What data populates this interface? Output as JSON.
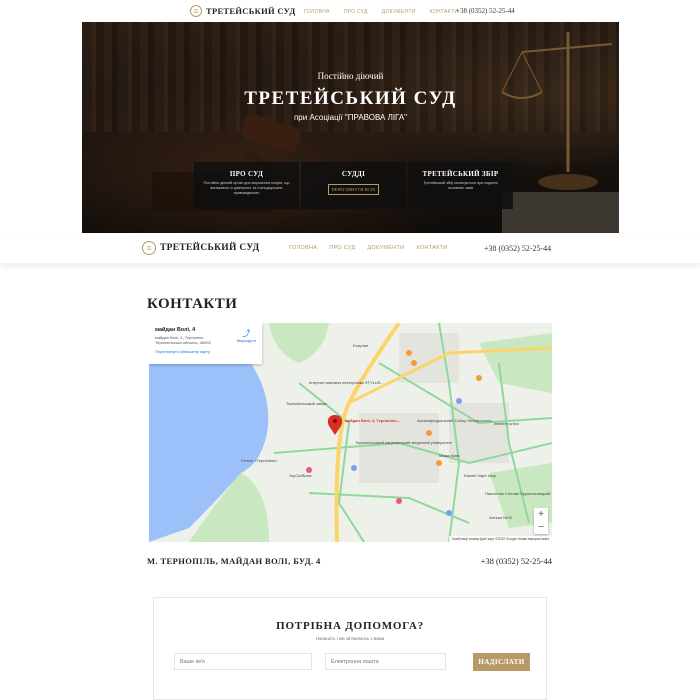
{
  "brand": {
    "name": "ТРЕТЕЙСЬКИЙ СУД"
  },
  "nav": {
    "home": "ГОЛОВНА",
    "about": "ПРО СУД",
    "docs": "ДОКУМЕНТИ",
    "contacts": "КОНТАКТИ"
  },
  "phone": "+38 (0352) 52-25-44",
  "hero": {
    "kicker": "Постійно діючий",
    "title": "ТРЕТЕЙСЬКИЙ СУД",
    "subtitle": "при Асоціації \"ПРАВОВА ЛІГА\"",
    "cards": [
      {
        "title": "ПРО СУД",
        "desc": "Постійно діючий орган для вирішення спорів, що виникають із цивільних та господарських правовідносин"
      },
      {
        "title": "СУДДІ",
        "button": "ПЕРЕГЛЯНУТИ ВСІХ"
      },
      {
        "title": "ТРЕТЕЙСЬКИЙ ЗБІР",
        "desc": "Третейський збір сплачується при поданні позовних заяв"
      }
    ]
  },
  "page_title": "КОНТАКТИ",
  "map": {
    "place": "майдан Волі, 4",
    "address": "майдан Волі, 4, Тернопіль, Тернопільська область, 46002",
    "larger_map": "Переглянути збільшену карту",
    "directions": "Маршрути",
    "pin_label": "майдан Волі, 4, Тернопіль...",
    "footer": "Комбінації клавіш   Дані карт ©2022 Google   Умови використання",
    "zoom_in": "+",
    "zoom_out": "−",
    "labels": [
      "Тернопільський замок",
      "Архикафедральний Собор Непорочного...",
      "Готель «Тернопіль»",
      "Тернопільський національний медичний університет",
      "Kandel Vape shop",
      "Пам'ятник Соломії Крушельницькій",
      "УкрСибБанк",
      "Аптека №78",
      "Інтернет-магазин електроніки STYLUS...",
      "western union",
      "Мама Кава",
      "Ескулап"
    ]
  },
  "address_line": "М. ТЕРНОПІЛЬ, МАЙДАН ВОЛІ, БУД. 4",
  "help": {
    "title": "ПОТРІБНА ДОПОМОГА?",
    "subtitle": "Напишіть і ми зв'яжемось з вами",
    "name_placeholder": "Ваше ім'я",
    "email_placeholder": "Електронна пошта",
    "submit": "НАДІСЛАТИ"
  },
  "colors": {
    "accent": "#b79a68",
    "dark": "#222222"
  }
}
